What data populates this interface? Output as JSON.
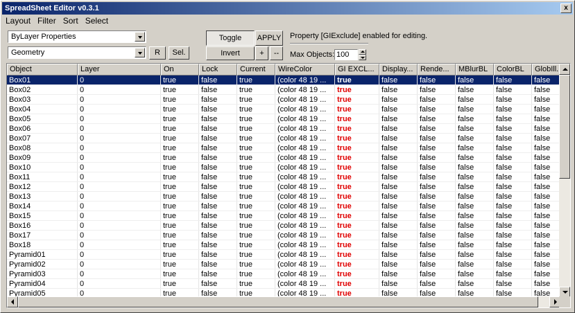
{
  "window": {
    "title": "SpreadSheet Editor v0.3.1",
    "close_glyph": "x"
  },
  "menu": [
    "Layout",
    "Filter",
    "Sort",
    "Select"
  ],
  "toolbar": {
    "properties_combo": "ByLayer Properties",
    "category_combo": "Geometry",
    "r_button": "R",
    "sel_button": "Sel.",
    "toggle_button": "Toggle",
    "apply_button": "APPLY",
    "invert_button": "Invert",
    "plus_button": "+",
    "minus_button": "--",
    "status_text": "Property [GIExclude] enabled for editing.",
    "max_objects_label": "Max Objects:",
    "max_objects_value": "100"
  },
  "columns": [
    "Object",
    "Layer",
    "On",
    "Lock",
    "Current",
    "WireColor",
    "GI EXCL...",
    "Display...",
    "Rende...",
    "MBlurBL",
    "ColorBL",
    "GlobIll..."
  ],
  "row_values": {
    "layer": "0",
    "on": "true",
    "lock": "false",
    "current": "true",
    "wirecolor": "(color 48 19 ...",
    "gi_exclude": "true",
    "display": "false",
    "render": "false",
    "mblur": "false",
    "colorbl": "false",
    "globill": "false"
  },
  "rows": [
    "Box01",
    "Box02",
    "Box03",
    "Box04",
    "Box05",
    "Box06",
    "Box07",
    "Box08",
    "Box09",
    "Box10",
    "Box11",
    "Box12",
    "Box13",
    "Box14",
    "Box15",
    "Box16",
    "Box17",
    "Box18",
    "Pyramid01",
    "Pyramid02",
    "Pyramid03",
    "Pyramid04",
    "Pyramid05"
  ],
  "selected_row": "Box01",
  "colors": {
    "selection": "#0a246a",
    "highlight_value": "#e00000",
    "face": "#d4d0c8"
  }
}
